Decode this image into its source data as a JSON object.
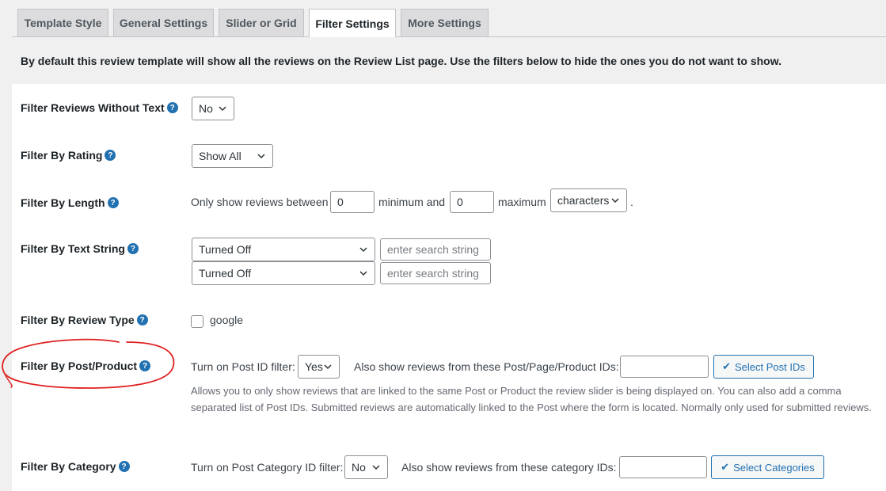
{
  "tabs": [
    {
      "label": "Template Style"
    },
    {
      "label": "General Settings"
    },
    {
      "label": "Slider or Grid"
    },
    {
      "label": "Filter Settings",
      "active": true
    },
    {
      "label": "More Settings"
    }
  ],
  "notice": "By default this review template will show all the reviews on the Review List page. Use the filters below to hide the ones you do not want to show.",
  "rows": {
    "without_text": {
      "label": "Filter Reviews Without Text",
      "value": "No"
    },
    "rating": {
      "label": "Filter By Rating",
      "value": "Show All"
    },
    "length": {
      "label": "Filter By Length",
      "prefix": "Only show reviews between",
      "min": "0",
      "middle": "minimum and",
      "max": "0",
      "suffix": "maximum",
      "unit": "characters",
      "period": "."
    },
    "text_string": {
      "label": "Filter By Text String",
      "rows": [
        {
          "mode": "Turned Off",
          "placeholder": "enter search string"
        },
        {
          "mode": "Turned Off",
          "placeholder": "enter search string"
        }
      ]
    },
    "review_type": {
      "label": "Filter By Review Type",
      "option": "google"
    },
    "post_product": {
      "label": "Filter By Post/Product",
      "toggle_label": "Turn on Post ID filter:",
      "toggle_value": "Yes",
      "also_label": "Also show reviews from these Post/Page/Product IDs:",
      "ids_value": "",
      "button": "Select Post IDs",
      "description": "Allows you to only show reviews that are linked to the same Post or Product the review slider is being displayed on. You can also add a comma separated list of Post IDs. Submitted reviews are automatically linked to the Post where the form is located. Normally only used for submitted reviews."
    },
    "category": {
      "label": "Filter By Category",
      "toggle_label": "Turn on Post Category ID filter:",
      "toggle_value": "No",
      "also_label": "Also show reviews from these category IDs:",
      "ids_value": "",
      "button": "Select Categories"
    }
  },
  "help_glyph": "?",
  "check_glyph": "✔",
  "colors": {
    "accent": "#2271b1",
    "annotation": "#e02020"
  }
}
